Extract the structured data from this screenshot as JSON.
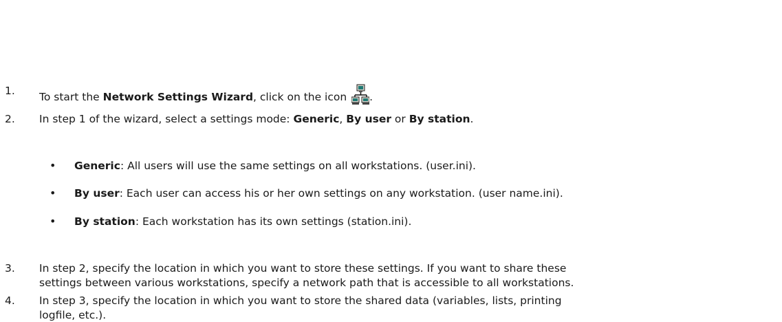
{
  "steps": [
    {
      "number": "1.",
      "pre": "To start the ",
      "bold": "Network Settings Wizard",
      "post": ", click on the icon",
      "tail": "."
    },
    {
      "number": "2.",
      "pre": "In step 1 of the wizard, select a settings mode: ",
      "mode1": "Generic",
      "sep1": ", ",
      "mode2": "By user",
      "sep2": " or ",
      "mode3": "By station",
      "tail": "."
    },
    {
      "number": "3.",
      "line1": "In step 2, specify the location in which you want to store these settings. If you want to share these",
      "line2": "settings between various workstations, specify a network path that is accessible to all workstations."
    },
    {
      "number": "4.",
      "line1": "In step 3, specify the location in which you want to store the shared data (variables, lists, printing",
      "line2": "logfile, etc.)."
    }
  ],
  "bullets": [
    {
      "term": "Generic",
      "text": ": All users will use the same settings on all workstations. (user.ini)."
    },
    {
      "term": "By user",
      "text": ": Each user can access his or her own settings on any workstation. (user name.ini)."
    },
    {
      "term": "By station",
      "text": ": Each workstation has its own settings (station.ini)."
    }
  ],
  "icons": {
    "wizard": "network-computers-icon"
  }
}
